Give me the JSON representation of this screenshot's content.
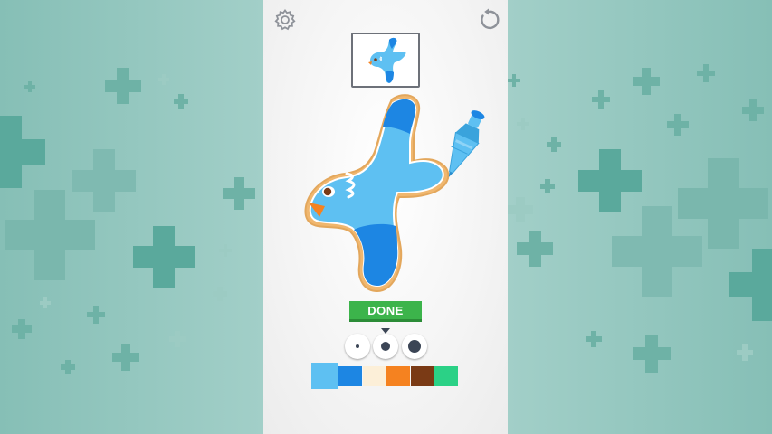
{
  "game": {
    "done_label": "DONE",
    "icons": {
      "settings": "gear-icon",
      "restart": "restart-icon"
    },
    "brush_sizes": [
      "small",
      "medium",
      "large"
    ],
    "selected_brush": "medium",
    "palette": [
      {
        "name": "light-blue",
        "color": "#5ec0f2",
        "selected": true
      },
      {
        "name": "blue",
        "color": "#1d86e3",
        "selected": false
      },
      {
        "name": "cream",
        "color": "#fcefd8",
        "selected": false
      },
      {
        "name": "orange",
        "color": "#f58220",
        "selected": false
      },
      {
        "name": "brown",
        "color": "#7a3a15",
        "selected": false
      },
      {
        "name": "green",
        "color": "#2bd186",
        "selected": false
      }
    ],
    "colors": {
      "background": "#8cc3bb",
      "pattern": "#4fa494",
      "done_button": "#3cb44b"
    }
  }
}
